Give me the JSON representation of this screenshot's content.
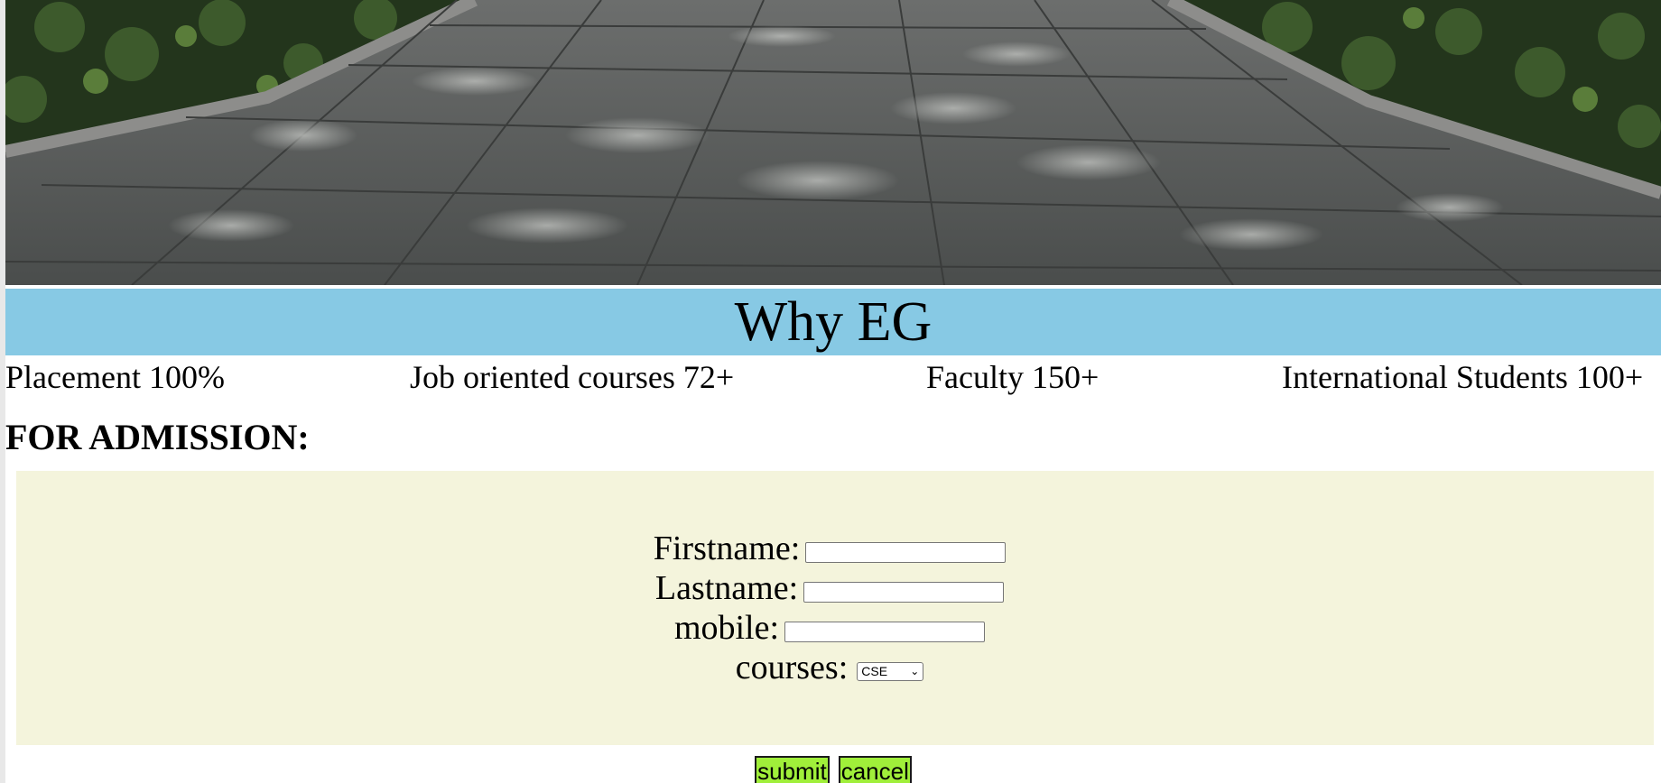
{
  "hero": {
    "image": "stone-walkway-photo"
  },
  "banner": {
    "title": "Why EG",
    "color": "#87c9e4"
  },
  "stats": [
    {
      "text": "Placement 100%"
    },
    {
      "text": "Job oriented courses 72+"
    },
    {
      "text": "Faculty 150+"
    },
    {
      "text": "International Students 100+"
    }
  ],
  "admission": {
    "heading": "FOR ADMISSION:",
    "panel_color": "#f4f4dc",
    "fields": {
      "firstname": {
        "label": "Firstname:",
        "value": ""
      },
      "lastname": {
        "label": "Lastname:",
        "value": ""
      },
      "mobile": {
        "label": "mobile:",
        "value": ""
      },
      "courses": {
        "label": "courses:",
        "selected": "CSE"
      }
    },
    "buttons": {
      "submit": "submit",
      "cancel": "cancel",
      "color": "#a0ef3a"
    }
  }
}
